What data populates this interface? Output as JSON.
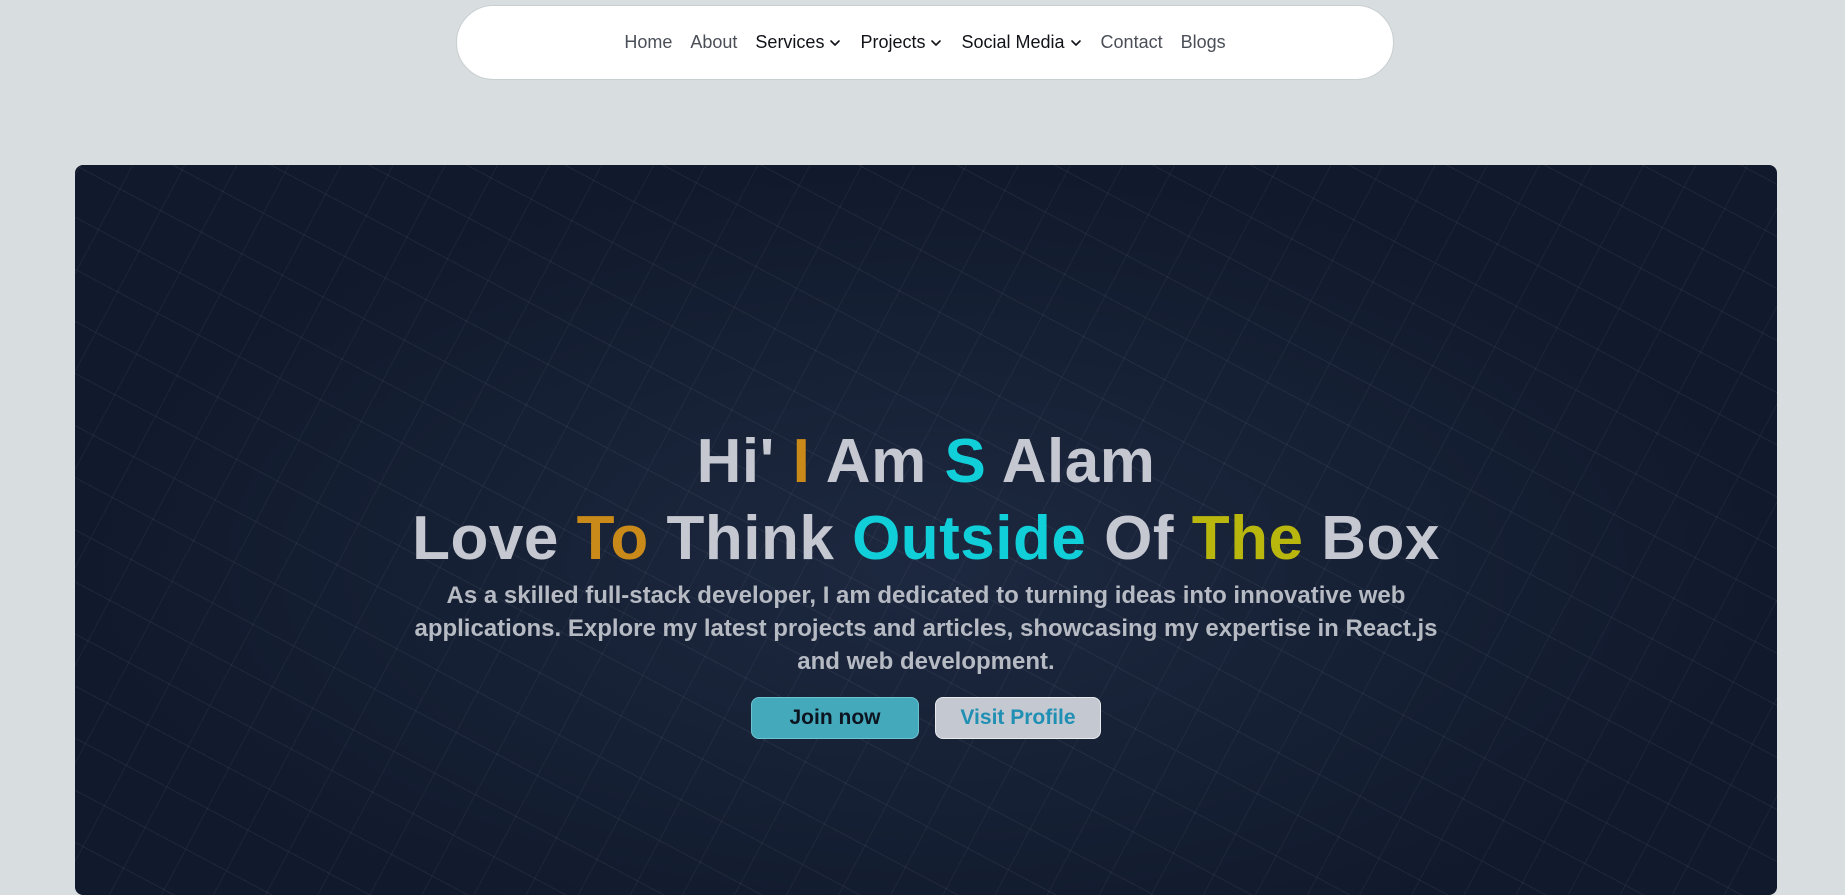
{
  "nav": {
    "items": [
      {
        "label": "Home",
        "dropdown": false
      },
      {
        "label": "About",
        "dropdown": false
      },
      {
        "label": "Services",
        "dropdown": true
      },
      {
        "label": "Projects",
        "dropdown": true
      },
      {
        "label": "Social Media",
        "dropdown": true
      },
      {
        "label": "Contact",
        "dropdown": false
      },
      {
        "label": "Blogs",
        "dropdown": false
      }
    ],
    "dropdown_icon": "chevron-down-icon"
  },
  "hero": {
    "line1": [
      "Hi'",
      "I",
      "Am",
      "S",
      "Alam"
    ],
    "line2": [
      "Love",
      "To",
      "Think",
      "Outside",
      "Of",
      "The",
      "Box"
    ],
    "description": "As a skilled full-stack developer, I am dedicated to turning ideas into innovative web applications. Explore my latest projects and articles, showcasing my expertise in React.js and web development.",
    "join_label": "Join now",
    "visit_label": "Visit Profile"
  },
  "colors": {
    "page_bg": "#d8dedf",
    "hero_bg": "#111a2c",
    "accent_orange": "#c98a19",
    "accent_cyan": "#11cfd9",
    "accent_yellow": "#b9b70e",
    "join_button_bg": "#45a9bc",
    "visit_button_bg": "#c4c8d0"
  }
}
